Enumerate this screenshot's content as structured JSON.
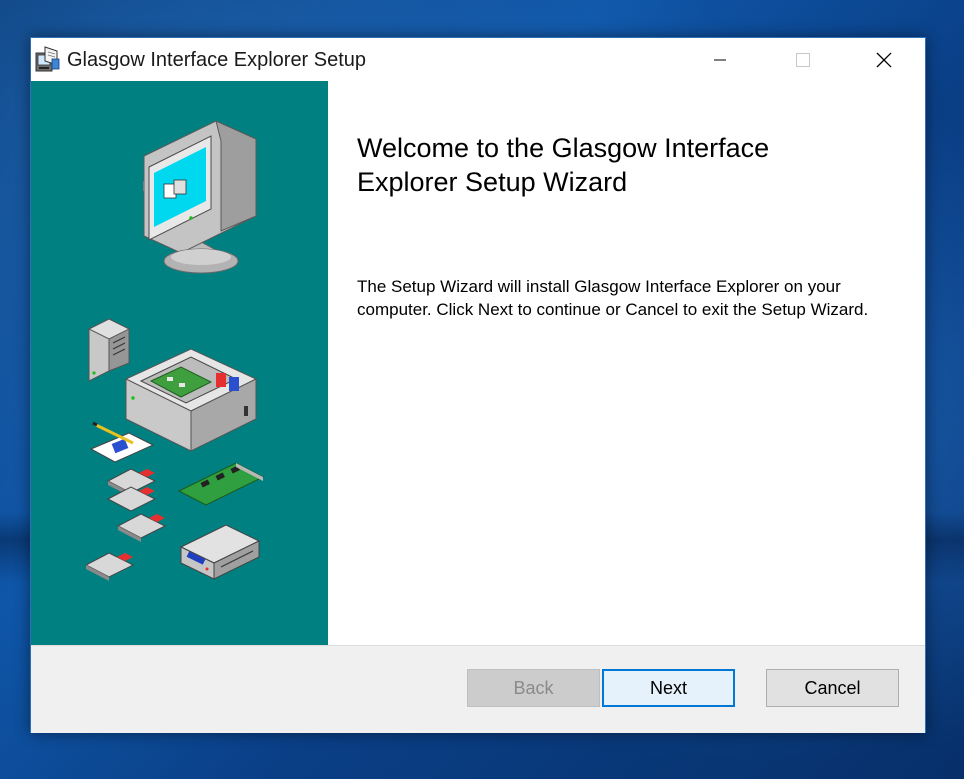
{
  "window": {
    "title": "Glasgow Interface Explorer Setup"
  },
  "titlebar": {
    "icons": [
      "installer-icon",
      "minimize-icon",
      "maximize-icon",
      "close-icon"
    ]
  },
  "wizard": {
    "heading": "Welcome to the Glasgow Interface Explorer Setup Wizard",
    "body": "The Setup Wizard will install Glasgow Interface Explorer on your computer. Click Next to continue or Cancel to exit the Setup Wizard.",
    "side_panel_color": "#008080"
  },
  "footer": {
    "back_label": "Back",
    "next_label": "Next",
    "cancel_label": "Cancel",
    "back_enabled": false
  },
  "colors": {
    "accent": "#0078d7",
    "desktop": "#0f56a8"
  }
}
